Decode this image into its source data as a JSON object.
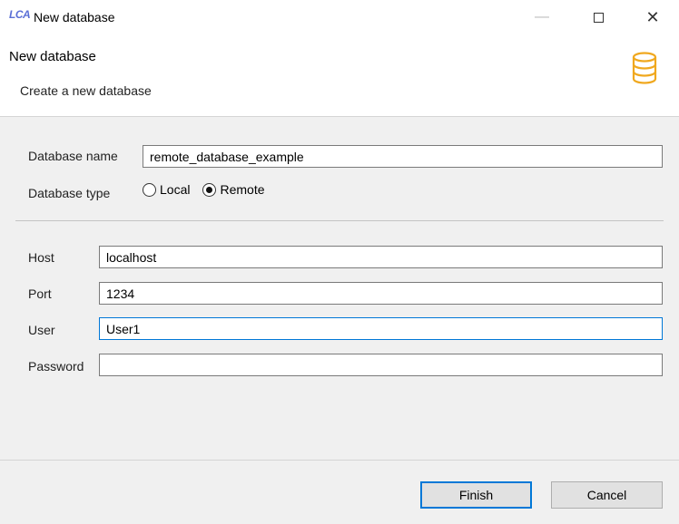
{
  "window": {
    "logo_text": "LCA",
    "title": "New database",
    "minimize_glyph": "—",
    "close_glyph": "✕"
  },
  "header": {
    "title": "New database",
    "description": "Create a new database",
    "icon": "database-icon",
    "icon_color": "#f0a81e"
  },
  "form": {
    "database_name_label": "Database name",
    "database_name_value": "remote_database_example",
    "database_type_label": "Database type",
    "type_options": [
      {
        "label": "Local",
        "checked": false
      },
      {
        "label": "Remote",
        "checked": true
      }
    ],
    "host_label": "Host",
    "host_value": "localhost",
    "port_label": "Port",
    "port_value": "1234",
    "user_label": "User",
    "user_value": "User1",
    "password_label": "Password",
    "password_value": ""
  },
  "footer": {
    "finish_label": "Finish",
    "cancel_label": "Cancel"
  },
  "colors": {
    "focus_border": "#0078d7",
    "panel_bg": "#f0f0f0"
  }
}
